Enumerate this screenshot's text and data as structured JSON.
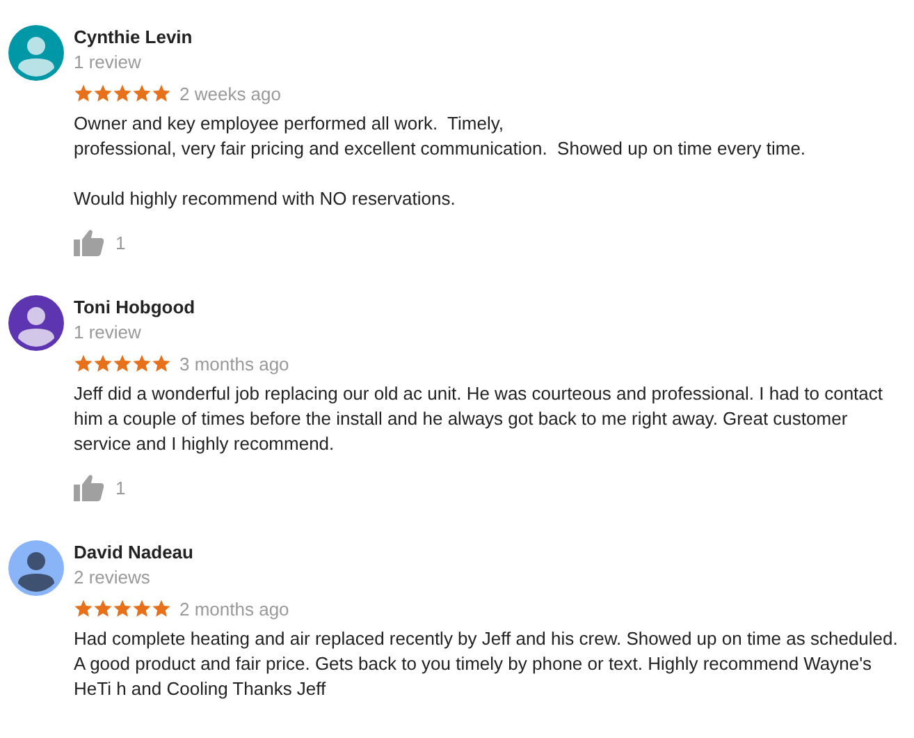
{
  "reviews": [
    {
      "author": "Cynthie Levin",
      "review_count": "1 review",
      "color": "#0097a7",
      "stars": 5,
      "time": "2 weeks ago",
      "paragraphs": [
        [
          "Owner and key employee performed all work.  Timely,",
          "professional, very fair pricing and excellent communication.  Showed up on time every time."
        ],
        [
          "Would highly recommend with NO reservations."
        ]
      ],
      "likes": "1"
    },
    {
      "author": "Toni Hobgood",
      "review_count": "1 review",
      "color": "#5e35b1",
      "stars": 5,
      "time": "3 months ago",
      "paragraphs": [
        [
          "Jeff did a wonderful job replacing our old ac unit. He was courteous and professional. I had to contact",
          "him a couple of times before the install and he always got back to me right away. Great customer",
          "service and I highly recommend."
        ]
      ],
      "likes": "1"
    },
    {
      "author": "David Nadeau",
      "review_count": "2 reviews",
      "color": "#8ab4f8",
      "stars": 5,
      "time": "2 months ago",
      "paragraphs": [
        [
          "Had complete heating and air replaced recently by Jeff and his crew. Showed up on time as scheduled.",
          "A good product and fair price. Gets back to you timely by phone or text. Highly recommend Wayne's",
          "HeTi h and Cooling Thanks Jeff"
        ]
      ]
    }
  ]
}
